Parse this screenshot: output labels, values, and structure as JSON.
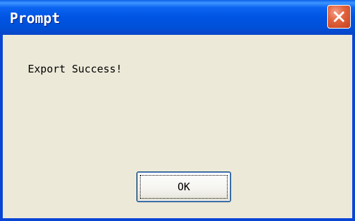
{
  "window": {
    "title": "Prompt",
    "close_icon": "close-icon",
    "titlebar_color": "#0054e3",
    "close_button_color": "#e2653f"
  },
  "dialog": {
    "message": "Export Success!",
    "ok_label": "OK"
  }
}
